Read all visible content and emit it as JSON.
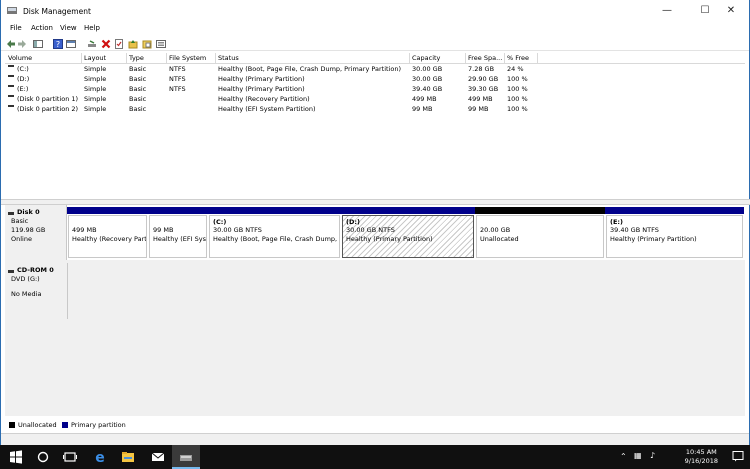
{
  "window": {
    "title": "Disk Management"
  },
  "menu": [
    "File",
    "Action",
    "View",
    "Help"
  ],
  "columns": [
    "Volume",
    "Layout",
    "Type",
    "File System",
    "Status",
    "Capacity",
    "Free Spa...",
    "% Free"
  ],
  "volumes": [
    {
      "volume": "(C:)",
      "layout": "Simple",
      "type": "Basic",
      "fs": "NTFS",
      "status": "Healthy (Boot, Page File, Crash Dump, Primary Partition)",
      "capacity": "30.00 GB",
      "free": "7.28 GB",
      "pct": "24 %"
    },
    {
      "volume": "(D:)",
      "layout": "Simple",
      "type": "Basic",
      "fs": "NTFS",
      "status": "Healthy (Primary Partition)",
      "capacity": "30.00 GB",
      "free": "29.90 GB",
      "pct": "100 %"
    },
    {
      "volume": "(E:)",
      "layout": "Simple",
      "type": "Basic",
      "fs": "NTFS",
      "status": "Healthy (Primary Partition)",
      "capacity": "39.40 GB",
      "free": "39.30 GB",
      "pct": "100 %"
    },
    {
      "volume": "(Disk 0 partition 1)",
      "layout": "Simple",
      "type": "Basic",
      "fs": "",
      "status": "Healthy (Recovery Partition)",
      "capacity": "499 MB",
      "free": "499 MB",
      "pct": "100 %"
    },
    {
      "volume": "(Disk 0 partition 2)",
      "layout": "Simple",
      "type": "Basic",
      "fs": "",
      "status": "Healthy (EFI System Partition)",
      "capacity": "99 MB",
      "free": "99 MB",
      "pct": "100 %"
    }
  ],
  "disk0": {
    "name": "Disk 0",
    "type": "Basic",
    "size": "119.98 GB",
    "state": "Online",
    "partitions": [
      {
        "title": "",
        "size": "499 MB",
        "status": "Healthy (Recovery Parti"
      },
      {
        "title": "",
        "size": "99 MB",
        "status": "Healthy (EFI Syst"
      },
      {
        "title": "(C:)",
        "size": "30.00 GB NTFS",
        "status": "Healthy (Boot, Page File, Crash Dump, Pr"
      },
      {
        "title": "(D:)",
        "size": "30.00 GB NTFS",
        "status": "Healthy (Primary Partition)"
      },
      {
        "title": "",
        "size": "20.00 GB",
        "status": "Unallocated"
      },
      {
        "title": "(E:)",
        "size": "39.40 GB NTFS",
        "status": "Healthy (Primary Partition)"
      }
    ]
  },
  "cdrom": {
    "name": "CD-ROM 0",
    "type": "DVD (G:)",
    "media": "No Media"
  },
  "legend": {
    "unallocated": "Unallocated",
    "primary": "Primary partition"
  },
  "colors": {
    "primary": "#00008b",
    "unallocated": "#000000"
  },
  "taskbar": {
    "time": "10:45 AM",
    "date": "9/16/2018"
  },
  "icons": [
    "windows-start-icon",
    "search-icon",
    "task-view-icon",
    "edge-icon",
    "file-explorer-icon",
    "mail-icon",
    "disk-management-icon"
  ]
}
